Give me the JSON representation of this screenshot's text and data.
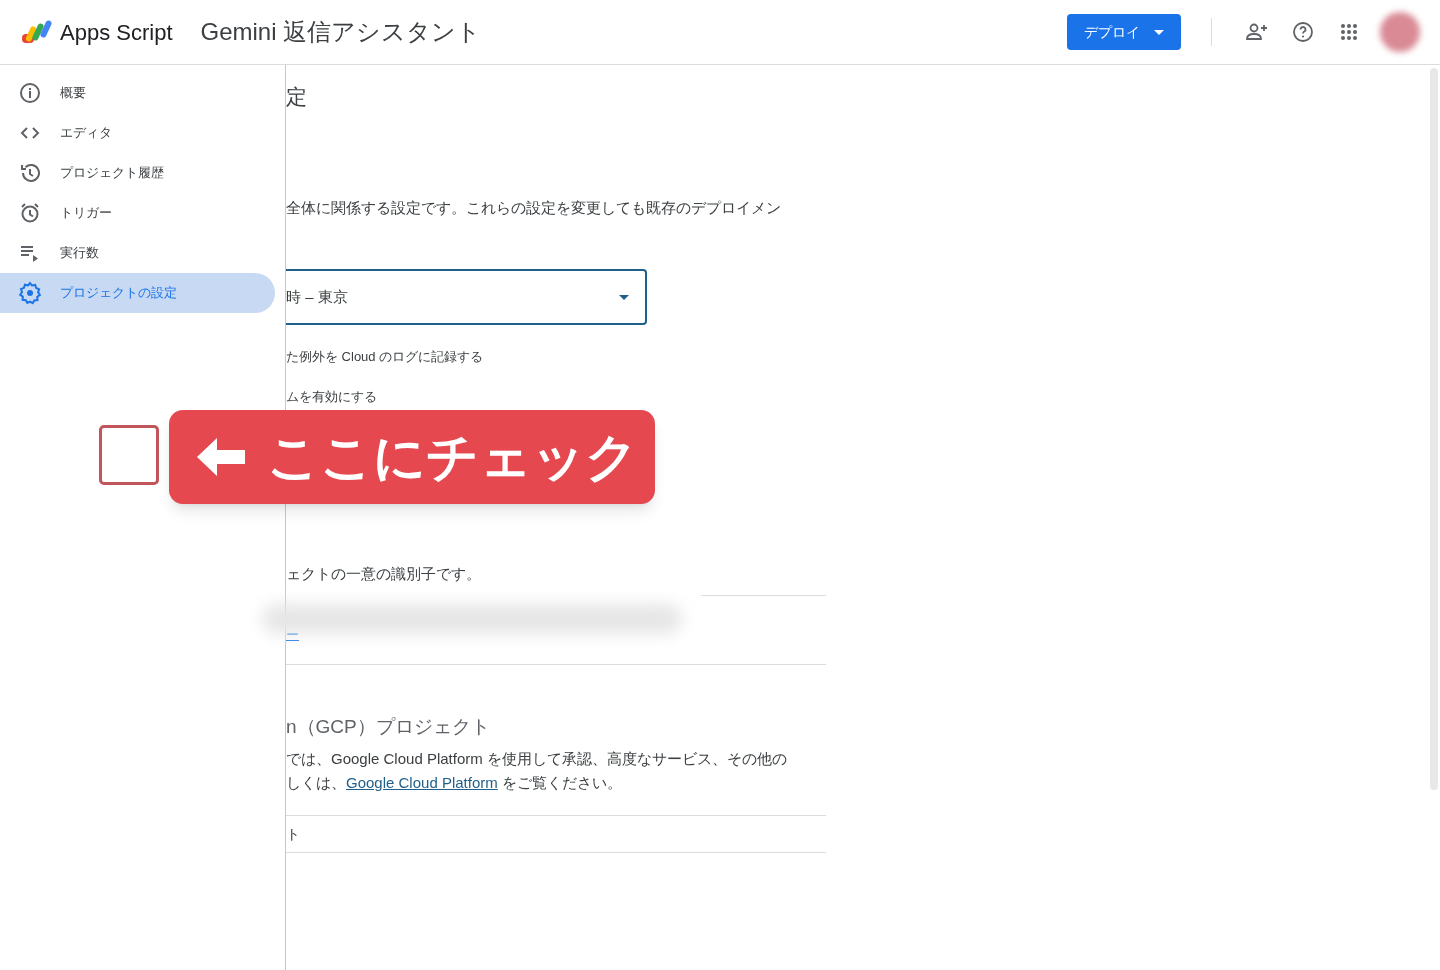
{
  "header": {
    "logo_text": "Apps Script",
    "project_title": "Gemini 返信アシスタント",
    "deploy_button": "デプロイ"
  },
  "sidebar": {
    "items": [
      {
        "label": "概要",
        "kind": "info",
        "selected": false
      },
      {
        "label": "エディタ",
        "kind": "code",
        "selected": false
      },
      {
        "label": "プロジェクト履歴",
        "kind": "history",
        "selected": false
      },
      {
        "label": "トリガー",
        "kind": "alarm",
        "selected": false
      },
      {
        "label": "実行数",
        "kind": "executions",
        "selected": false
      },
      {
        "label": "プロジェクトの設定",
        "kind": "settings",
        "selected": true
      }
    ]
  },
  "content": {
    "title": "定",
    "description": "全体に関係する設定です。これらの設定を変更しても既存のデプロイメン",
    "timezone_select": {
      "value": "時 – 東京"
    },
    "options": [
      {
        "label": "た例外を Cloud のログに記録する"
      },
      {
        "label": "ムを有効にする"
      }
    ],
    "id_description": "ェクトの一意の識別子です。",
    "id_link": "ー",
    "gcp_heading": "n（GCP）プロジェクト",
    "gcp_line_1": "では、Google Cloud Platform を使用して承認、高度なサービス、その他の",
    "gcp_line_2": {
      "before": "しくは、",
      "link": "Google Cloud Platform",
      "after": " をご覧ください。"
    },
    "gcp_row": "ト"
  },
  "annotation": {
    "checkbox": {
      "checked": false
    },
    "text": "ここにチェック"
  }
}
